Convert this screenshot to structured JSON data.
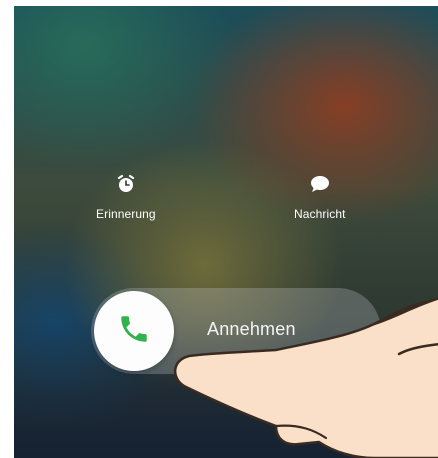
{
  "actions": {
    "reminder": {
      "label": "Erinnerung",
      "icon": "alarm-clock-icon"
    },
    "message": {
      "label": "Nachricht",
      "icon": "speech-bubble-icon"
    }
  },
  "slider": {
    "label": "Annehmen",
    "icon": "phone-icon",
    "icon_color": "#32b24d"
  }
}
